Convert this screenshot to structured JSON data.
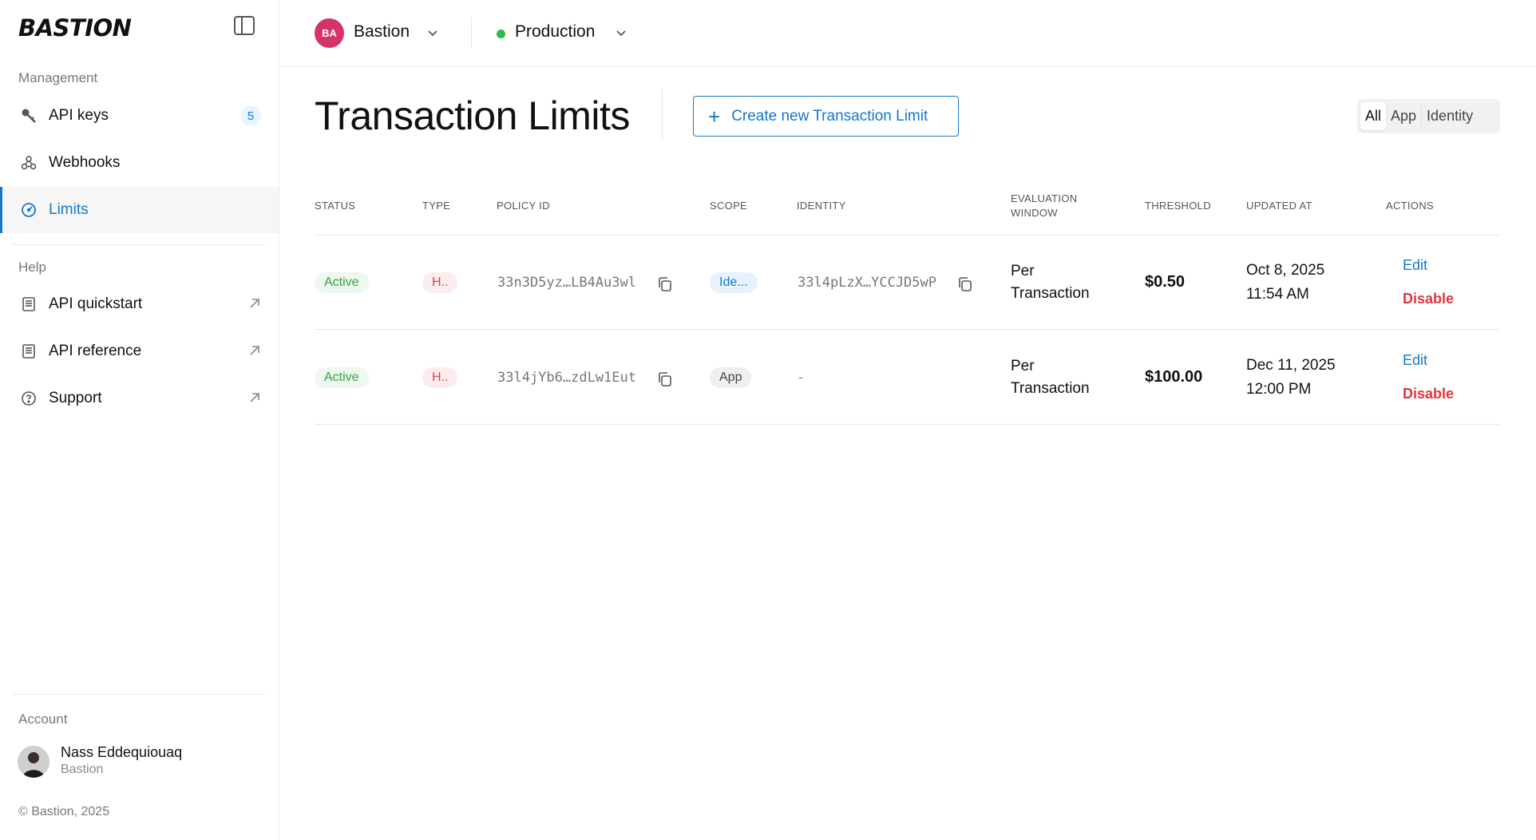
{
  "sidebar": {
    "logo": "BASTION",
    "management_label": "Management",
    "help_label": "Help",
    "account_label": "Account",
    "items": [
      {
        "label": "API keys",
        "badge": "5",
        "icon": "key-icon"
      },
      {
        "label": "Webhooks",
        "icon": "webhook-icon"
      },
      {
        "label": "Limits",
        "icon": "gauge-icon",
        "active": true
      }
    ],
    "help_items": [
      {
        "label": "API quickstart",
        "icon": "book-icon"
      },
      {
        "label": "API reference",
        "icon": "book-icon"
      },
      {
        "label": "Support",
        "icon": "help-circle-icon"
      }
    ],
    "account": {
      "name": "Nass Eddequiouaq",
      "org": "Bastion"
    },
    "copyright": "© Bastion, 2025"
  },
  "topbar": {
    "org_initials": "BA",
    "org_name": "Bastion",
    "environment": "Production",
    "env_color": "#2dbb4e"
  },
  "header": {
    "title": "Transaction Limits",
    "create_button": "Create new Transaction Limit",
    "filters": [
      "All",
      "App",
      "Identity"
    ],
    "active_filter": "All"
  },
  "table": {
    "columns": [
      "STATUS",
      "TYPE",
      "POLICY ID",
      "SCOPE",
      "IDENTITY",
      "EVALUATION",
      "WINDOW",
      "THRESHOLD",
      "UPDATED AT",
      "ACTIONS"
    ],
    "rows": [
      {
        "status": "Active",
        "type": "H..",
        "policy_id": "33n3D5yz…LB4Au3wl",
        "scope": "Ide...",
        "identity": "33l4pLzX…YCCJD5wP",
        "window_line1": "Per",
        "window_line2": "Transaction",
        "threshold": "$0.50",
        "updated_date": "Oct 8, 2025",
        "updated_time": "11:54 AM",
        "edit": "Edit",
        "disable": "Disable"
      },
      {
        "status": "Active",
        "type": "H..",
        "policy_id": "33l4jYb6…zdLw1Eut",
        "scope": "App",
        "identity": "-",
        "window_line1": "Per",
        "window_line2": "Transaction",
        "threshold": "$100.00",
        "updated_date": "Dec 11, 2025",
        "updated_time": "12:00 PM",
        "edit": "Edit",
        "disable": "Disable"
      }
    ]
  },
  "colors": {
    "accent": "#1478c8",
    "danger": "#e0353d",
    "success": "#36a047"
  }
}
